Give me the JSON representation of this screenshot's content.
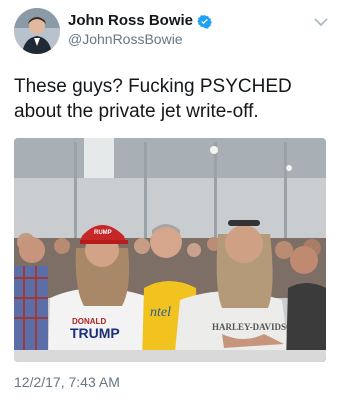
{
  "author": {
    "display_name": "John Ross Bowie",
    "handle": "@JohnRossBowie",
    "verified_icon": "verified-badge-icon",
    "avatar_icon": "avatar"
  },
  "tweet": {
    "text": "These guys? Fucking PSYCHED about the private jet write-off.",
    "timestamp": "12/2/17, 7:43 AM",
    "media_description_icon": "crowd-photo"
  },
  "colors": {
    "verified_blue": "#1da1f2",
    "secondary_text": "#657786",
    "primary_text": "#14171a"
  }
}
